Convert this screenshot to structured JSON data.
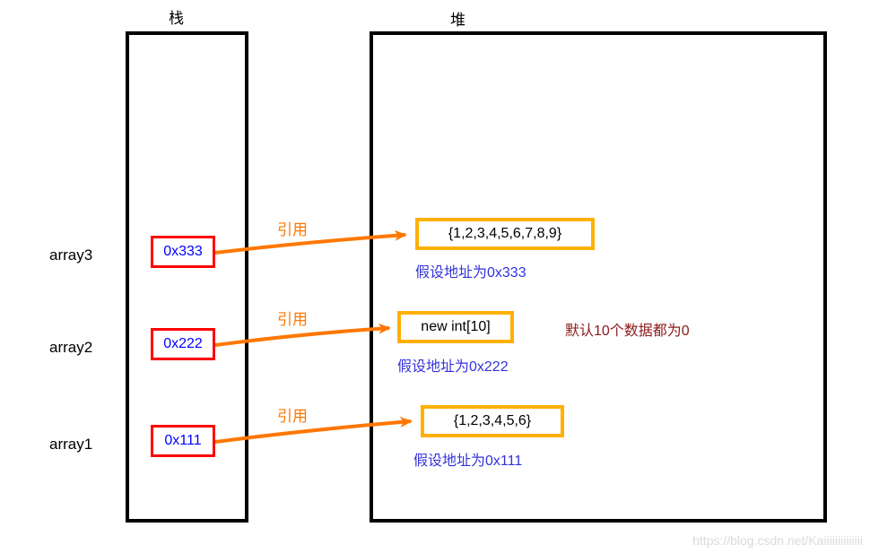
{
  "headers": {
    "stack": "栈",
    "heap": "堆"
  },
  "stack": {
    "items": [
      {
        "name": "array3",
        "address": "0x333"
      },
      {
        "name": "array2",
        "address": "0x222"
      },
      {
        "name": "array1",
        "address": "0x111"
      }
    ]
  },
  "heap": {
    "items": [
      {
        "content": "{1,2,3,4,5,6,7,8,9}",
        "note": "假设地址为0x333",
        "extra": ""
      },
      {
        "content": "new int[10]",
        "note": "假设地址为0x222",
        "extra": "默认10个数据都为0"
      },
      {
        "content": "{1,2,3,4,5,6}",
        "note": "假设地址为0x111",
        "extra": ""
      }
    ]
  },
  "arrow_label": "引用",
  "watermark": "https://blog.csdn.net/Kaiiiiiiiiiiiiii",
  "colors": {
    "stack_border": "#ff0000",
    "stack_text": "#0000ff",
    "heap_border": "#ffb000",
    "arrow": "#ff7700",
    "note": "#3333dd",
    "extra": "#8b1a1a"
  }
}
